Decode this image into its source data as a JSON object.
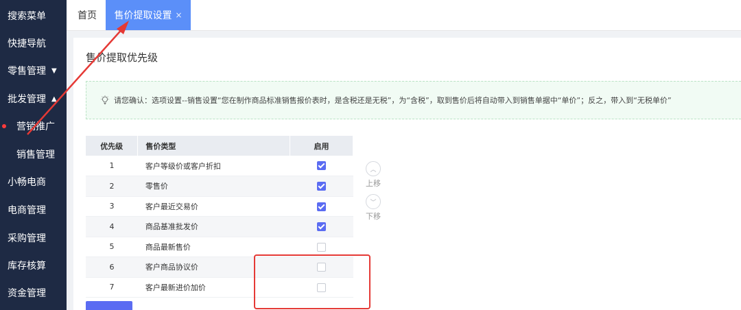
{
  "sidebar": {
    "items": [
      {
        "label": "搜索菜单",
        "arrow": ""
      },
      {
        "label": "快捷导航",
        "arrow": ""
      },
      {
        "label": "零售管理",
        "arrow": "▼"
      },
      {
        "label": "批发管理",
        "arrow": "▲"
      },
      {
        "label": "营销推广",
        "arrow": ""
      },
      {
        "label": "销售管理",
        "arrow": ""
      },
      {
        "label": "小畅电商",
        "arrow": ""
      },
      {
        "label": "电商管理",
        "arrow": ""
      },
      {
        "label": "采购管理",
        "arrow": ""
      },
      {
        "label": "库存核算",
        "arrow": ""
      },
      {
        "label": "资金管理",
        "arrow": ""
      }
    ]
  },
  "tabs": {
    "home": "首页",
    "current": "售价提取设置",
    "close": "×"
  },
  "page": {
    "title": "售价提取优先级",
    "notice": "请您确认：选项设置--销售设置“您在制作商品标准销售报价表时，是含税还是无税”，为“含税”，取到售价后将自动带入到销售单据中“单价”；反之，带入到“无税单价”"
  },
  "table": {
    "headers": {
      "no": "优先级",
      "type": "售价类型",
      "enabled": "启用"
    },
    "rows": [
      {
        "no": "1",
        "type": "客户等级价或客户折扣",
        "enabled": true
      },
      {
        "no": "2",
        "type": "零售价",
        "enabled": true
      },
      {
        "no": "3",
        "type": "客户最近交易价",
        "enabled": true
      },
      {
        "no": "4",
        "type": "商品基准批发价",
        "enabled": true
      },
      {
        "no": "5",
        "type": "商品最新售价",
        "enabled": false
      },
      {
        "no": "6",
        "type": "客户商品协议价",
        "enabled": false
      },
      {
        "no": "7",
        "type": "客户最新进价加价",
        "enabled": false
      }
    ]
  },
  "move": {
    "up": "上移",
    "down": "下移"
  },
  "colors": {
    "sidebar": "#1e2a44",
    "accent": "#5b8ff9",
    "checkbox": "#5b6cf2",
    "annotation": "#e53935"
  }
}
